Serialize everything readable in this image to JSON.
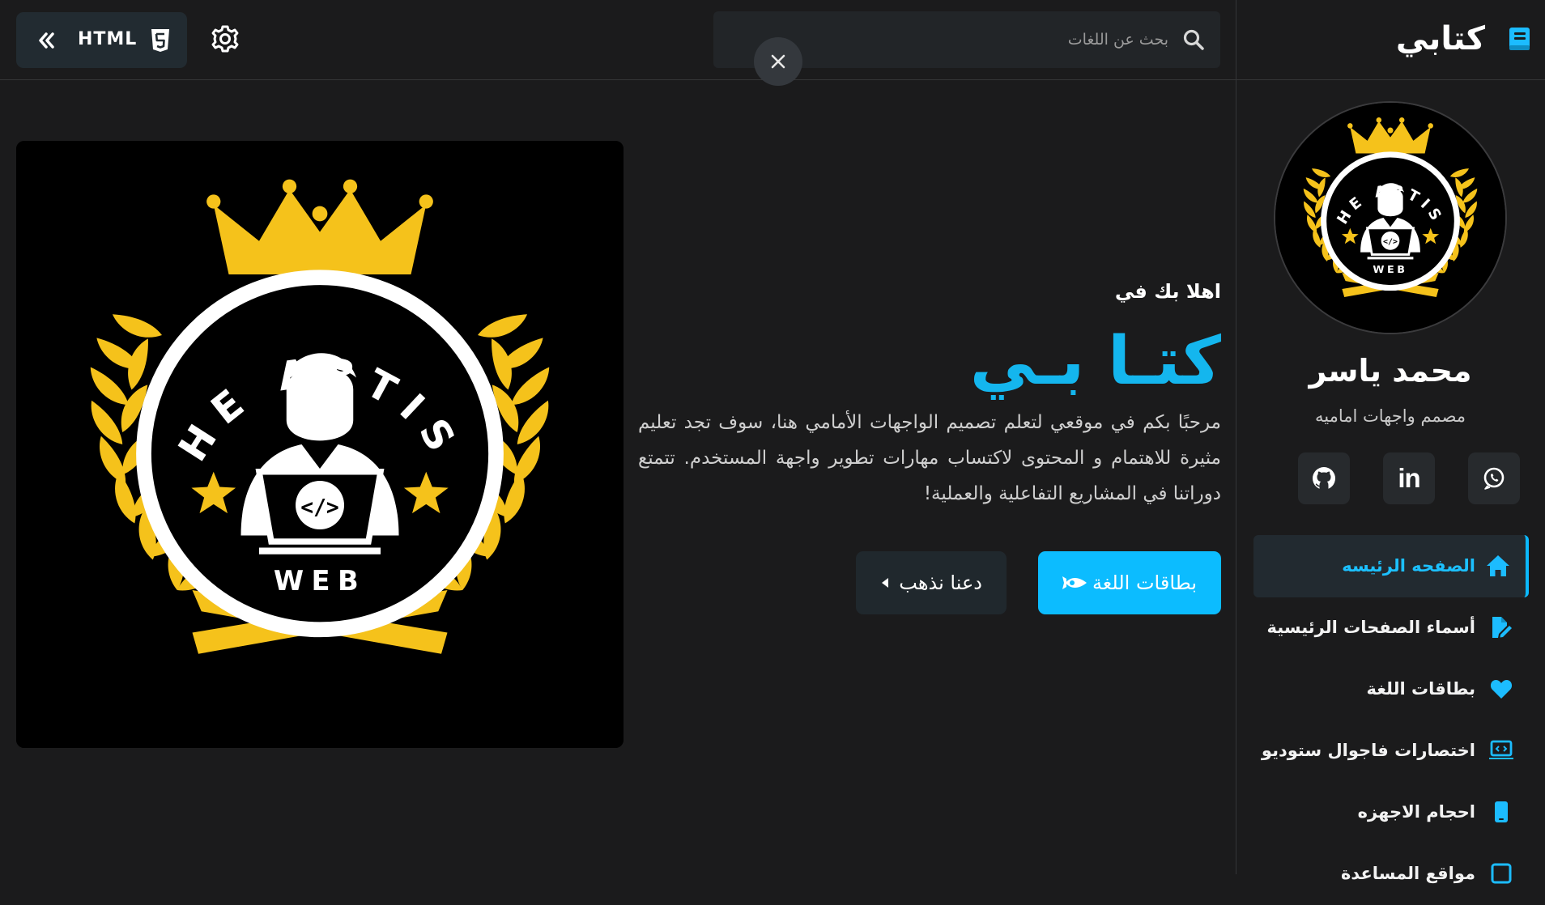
{
  "brand": {
    "title": "كتابي",
    "icon": "book-icon"
  },
  "profile": {
    "name": "محمد ياسر",
    "role": "مصمم واجهات اماميه",
    "logo_text_top": "THE ARTIST",
    "logo_text_bottom": "WEB"
  },
  "socials": [
    {
      "name": "whatsapp",
      "icon": "whatsapp-icon"
    },
    {
      "name": "linkedin",
      "icon": "linkedin-icon",
      "glyph": "in"
    },
    {
      "name": "github",
      "icon": "github-icon"
    }
  ],
  "nav": {
    "items": [
      {
        "label": "الصفحه الرئيسه",
        "icon": "home-icon",
        "active": true
      },
      {
        "label": "أسماء الصفحات الرئيسية",
        "icon": "file-edit-icon",
        "active": false
      },
      {
        "label": "بطاقات اللغة",
        "icon": "heart-icon",
        "active": false
      },
      {
        "label": "اختصارات فاجوال ستوديو",
        "icon": "laptop-code-icon",
        "active": false
      },
      {
        "label": "احجام الاجهزه",
        "icon": "mobile-icon",
        "active": false
      },
      {
        "label": "مواقع المساعدة",
        "icon": "link-icon",
        "active": false
      }
    ]
  },
  "topbar": {
    "language_label": "HTML",
    "search_placeholder": "بحث عن اللغات"
  },
  "hero": {
    "eyebrow": "اهلا بك في",
    "title": "كتـا بـي",
    "description": "مرحبًا بكم في موقعي لتعلم تصميم الواجهات الأمامي هنا، سوف تجد تعليم مثيرة للاهتمام و المحتوى لاكتساب مهارات تطوير واجهة المستخدم. تتمتع دوراتنا في المشاريع التفاعلية والعملية!",
    "primary_button": "بطاقات اللغة",
    "secondary_button": "دعنا نذهب",
    "logo_text_top": "THE ARTIST",
    "logo_text_bottom": "WEB"
  },
  "colors": {
    "accent": "#0cbcff",
    "background": "#1b1b1c",
    "gold": "#f5c21b"
  }
}
